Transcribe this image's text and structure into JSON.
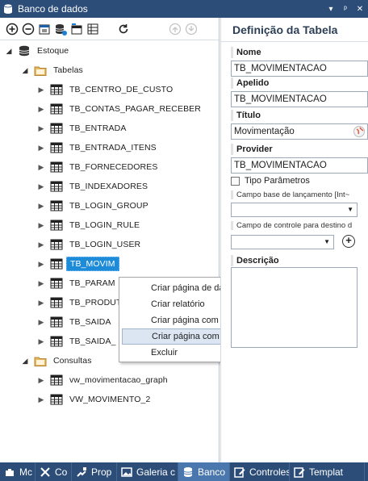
{
  "window": {
    "title": "Banco de dados"
  },
  "toolbar": {
    "icons": [
      "add-icon",
      "remove-icon",
      "import-icon",
      "database-add-icon",
      "table-icon",
      "grid-icon",
      "refresh-icon",
      "up-icon",
      "down-icon"
    ]
  },
  "tree": {
    "root": "Estoque",
    "tables_group": "Tabelas",
    "tables": [
      "TB_CENTRO_DE_CUSTO",
      "TB_CONTAS_PAGAR_RECEBER",
      "TB_ENTRADA",
      "TB_ENTRADA_ITENS",
      "TB_FORNECEDORES",
      "TB_INDEXADORES",
      "TB_LOGIN_GROUP",
      "TB_LOGIN_RULE",
      "TB_LOGIN_USER",
      "TB_MOVIM",
      "TB_PARAM",
      "TB_PRODUT",
      "TB_SAIDA",
      "TB_SAIDA_"
    ],
    "selected_index": 9,
    "queries_group": "Consultas",
    "queries": [
      "vw_movimentacao_graph",
      "VW_MOVIMENTO_2"
    ]
  },
  "context_menu": {
    "items": [
      "Criar página de dados",
      "Criar relatório",
      "Criar página com grid",
      "Criar página com repeater",
      "Excluir"
    ],
    "highlighted_index": 3
  },
  "definition": {
    "header": "Definição da Tabela",
    "nome_label": "Nome",
    "nome_value": "TB_MOVIMENTACAO",
    "apelido_label": "Apelido",
    "apelido_value": "TB_MOVIMENTACAO",
    "titulo_label": "Título",
    "titulo_value": "Movimentação",
    "provider_label": "Provider",
    "provider_value": "TB_MOVIMENTACAO",
    "tipo_parametros_label": "Tipo Parâmetros",
    "campo_base_label": "Campo base de lançamento [Int~",
    "campo_controle_label": "Campo de controle para destino d",
    "descricao_label": "Descrição"
  },
  "bottom_tabs": [
    {
      "label": "Mc",
      "icon": "puzzle-icon",
      "active": false
    },
    {
      "label": "Co",
      "icon": "tools-icon",
      "active": false
    },
    {
      "label": "Prop",
      "icon": "properties-icon",
      "active": false
    },
    {
      "label": "Galeria c",
      "icon": "image-icon",
      "active": false
    },
    {
      "label": "Banco",
      "icon": "database-icon",
      "active": true
    },
    {
      "label": "Controles c",
      "icon": "edit-icon",
      "active": false
    },
    {
      "label": "Templat",
      "icon": "edit-icon",
      "active": false
    }
  ]
}
